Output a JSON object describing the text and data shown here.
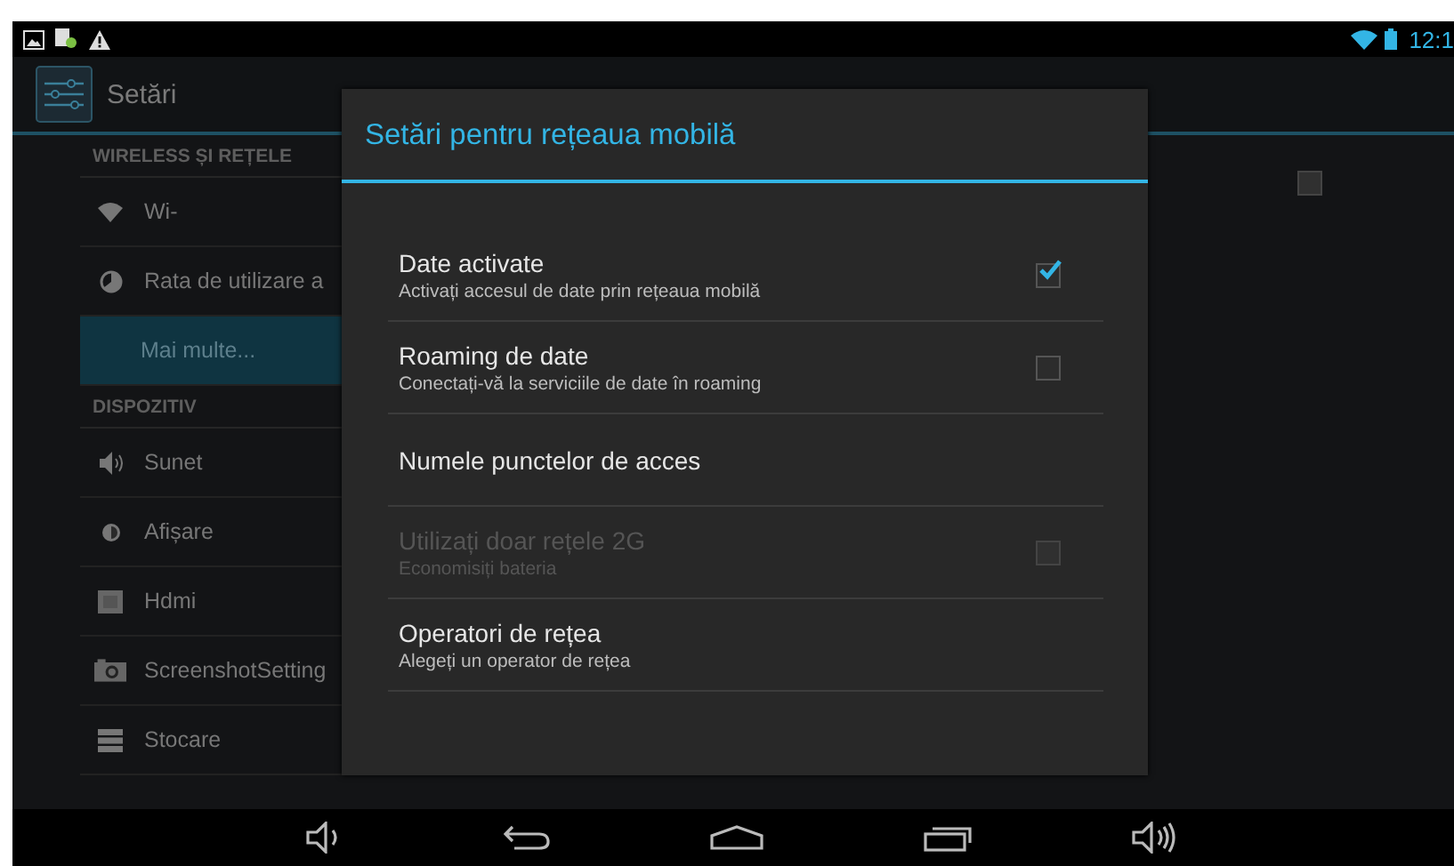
{
  "status_bar": {
    "time": "12:1"
  },
  "action_bar": {
    "title": "Setări"
  },
  "sidebar": {
    "sections": [
      {
        "header": "WIRELESS ȘI REȚELE",
        "items": [
          {
            "label": "Wi-",
            "kind": "wifi",
            "selected": false
          },
          {
            "label": "Rata de utilizare a",
            "kind": "data",
            "selected": false
          },
          {
            "label": "Mai multe...",
            "kind": "plain",
            "selected": true
          }
        ]
      },
      {
        "header": "DISPOZITIV",
        "items": [
          {
            "label": "Sunet",
            "kind": "sound",
            "selected": false
          },
          {
            "label": "Afișare",
            "kind": "display",
            "selected": false
          },
          {
            "label": "Hdmi",
            "kind": "hdmi",
            "selected": false
          },
          {
            "label": "ScreenshotSetting",
            "kind": "camera",
            "selected": false
          },
          {
            "label": "Stocare",
            "kind": "storage",
            "selected": false
          }
        ]
      }
    ]
  },
  "detail": {
    "checkbox": {
      "checked": false
    }
  },
  "dialog": {
    "title": "Setări pentru rețeaua mobilă",
    "items": [
      {
        "title": "Date activate",
        "summary": "Activați accesul de date prin rețeaua mobilă",
        "kind": "checkbox",
        "checked": true,
        "disabled": false
      },
      {
        "title": "Roaming de date",
        "summary": "Conectați-vă la serviciile de date în roaming",
        "kind": "checkbox",
        "checked": false,
        "disabled": false
      },
      {
        "title": "Numele punctelor de acces",
        "kind": "plain",
        "disabled": false
      },
      {
        "title": "Utilizați doar rețele 2G",
        "summary": "Economisiți bateria",
        "kind": "checkbox",
        "checked": false,
        "disabled": true
      },
      {
        "title": "Operatori de rețea",
        "summary": "Alegeți un operator de rețea",
        "kind": "plain",
        "disabled": false
      }
    ]
  }
}
